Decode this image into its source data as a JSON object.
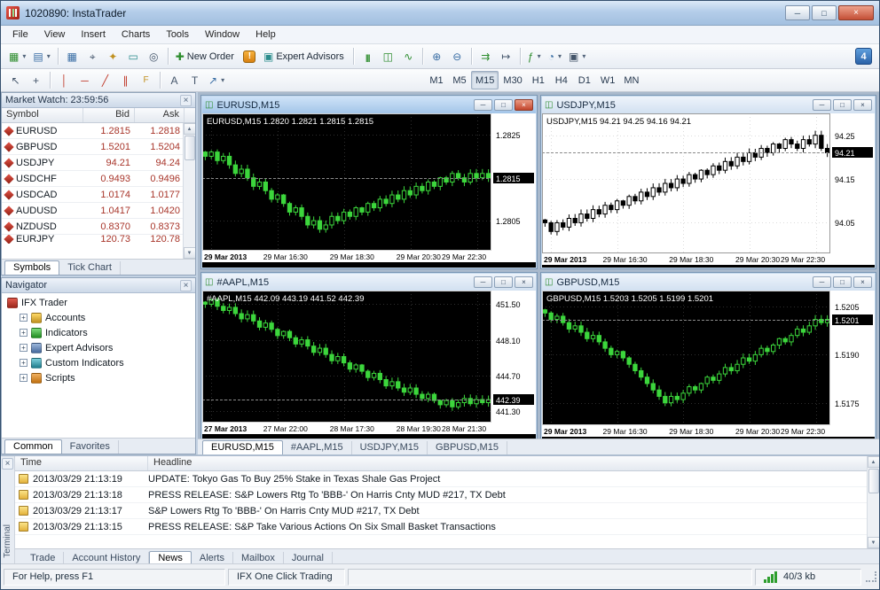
{
  "window": {
    "title": "1020890: InstaTrader"
  },
  "menu": {
    "items": [
      "File",
      "View",
      "Insert",
      "Charts",
      "Tools",
      "Window",
      "Help"
    ]
  },
  "toolbar": {
    "new_order_label": "New Order",
    "expert_advisors_label": "Expert Advisors",
    "notification_badge": "4",
    "timeframes": [
      "M1",
      "M5",
      "M15",
      "M30",
      "H1",
      "H4",
      "D1",
      "W1",
      "MN"
    ],
    "active_timeframe": "M15"
  },
  "icons": {
    "new_chart": "▦",
    "profiles": "▤",
    "market_watch": "▦",
    "data_window": "⌖",
    "navigator": "✦",
    "terminal_panel": "▭",
    "strategy_tester": "◎",
    "new_order": "✚",
    "alert": "!",
    "expert_advisors": "▣",
    "chart_bars": "|||",
    "chart_candles": "◫",
    "chart_line": "∿",
    "zoom_in": "⊕",
    "zoom_out": "⊖",
    "auto_scroll": "⇉",
    "chart_shift": "↦",
    "indicators": "ƒ",
    "periods": "◔",
    "templates": "▣",
    "dropdown": "▾",
    "cursor": "↖",
    "crosshair": "+",
    "vline": "│",
    "hline": "─",
    "trendline": "╱",
    "channel": "∥",
    "fibonacci": "F",
    "text": "A",
    "text_label": "T",
    "arrows": "↗",
    "minimize": "─",
    "maximize": "□",
    "close": "×",
    "scroll_up": "▲",
    "scroll_down": "▼",
    "expand": "+"
  },
  "market_watch": {
    "title": "Market Watch: 23:59:56",
    "columns": [
      "Symbol",
      "Bid",
      "Ask"
    ],
    "rows": [
      {
        "symbol": "EURUSD",
        "bid": "1.2815",
        "ask": "1.2818"
      },
      {
        "symbol": "GBPUSD",
        "bid": "1.5201",
        "ask": "1.5204"
      },
      {
        "symbol": "USDJPY",
        "bid": "94.21",
        "ask": "94.24"
      },
      {
        "symbol": "USDCHF",
        "bid": "0.9493",
        "ask": "0.9496"
      },
      {
        "symbol": "USDCAD",
        "bid": "1.0174",
        "ask": "1.0177"
      },
      {
        "symbol": "AUDUSD",
        "bid": "1.0417",
        "ask": "1.0420"
      },
      {
        "symbol": "NZDUSD",
        "bid": "0.8370",
        "ask": "0.8373"
      },
      {
        "symbol": "EURJPY",
        "bid": "120.73",
        "ask": "120.78"
      }
    ],
    "tabs": [
      "Symbols",
      "Tick Chart"
    ],
    "active_tab": "Symbols"
  },
  "navigator": {
    "title": "Navigator",
    "root": "IFX Trader",
    "items": [
      "Accounts",
      "Indicators",
      "Expert Advisors",
      "Custom Indicators",
      "Scripts"
    ],
    "tabs": [
      "Common",
      "Favorites"
    ],
    "active_tab": "Common"
  },
  "chart_tabs": {
    "items": [
      "EURUSD,M15",
      "#AAPL,M15",
      "USDJPY,M15",
      "GBPUSD,M15"
    ],
    "active": "EURUSD,M15"
  },
  "terminal": {
    "side_label": "Terminal",
    "columns": [
      "Time",
      "Headline"
    ],
    "news": [
      {
        "time": "2013/03/29 21:13:19",
        "headline": "UPDATE: Tokyo Gas To Buy 25% Stake in Texas Shale Gas Project"
      },
      {
        "time": "2013/03/29 21:13:18",
        "headline": "PRESS RELEASE: S&P Lowers Rtg To 'BBB-' On Harris Cnty MUD #217, TX Debt"
      },
      {
        "time": "2013/03/29 21:13:17",
        "headline": "S&P Lowers Rtg To 'BBB-' On Harris Cnty MUD #217, TX Debt"
      },
      {
        "time": "2013/03/29 21:13:15",
        "headline": "PRESS RELEASE: S&P Take Various Actions On Six Small Basket Transactions"
      }
    ],
    "tabs": [
      "Trade",
      "Account History",
      "News",
      "Alerts",
      "Mailbox",
      "Journal"
    ],
    "active_tab": "News"
  },
  "statusbar": {
    "help": "For Help, press F1",
    "one_click": "IFX One Click Trading",
    "traffic": "40/3 kb"
  },
  "chart_data": [
    {
      "type": "candlestick",
      "title": "EURUSD,M15",
      "theme": "dark",
      "info": "EURUSD,M15 1.2820 1.2821 1.2815 1.2815",
      "y_range": [
        1.2798,
        1.283
      ],
      "y_labels": [
        {
          "t": "1.2825",
          "v": 1.2825
        },
        {
          "t": "1.2815",
          "v": 1.2815,
          "hl": true
        },
        {
          "t": "1.2805",
          "v": 1.2805
        }
      ],
      "x_labels": [
        "29 Mar 2013",
        "29 Mar 16:30",
        "29 Mar 18:30",
        "29 Mar 20:30",
        "29 Mar 22:30"
      ],
      "closes": [
        1.282,
        1.2821,
        1.2819,
        1.282,
        1.2818,
        1.2816,
        1.2817,
        1.2815,
        1.2813,
        1.2814,
        1.2812,
        1.281,
        1.2811,
        1.2809,
        1.2807,
        1.2808,
        1.2806,
        1.2804,
        1.2805,
        1.2803,
        1.2804,
        1.2806,
        1.2805,
        1.2807,
        1.2806,
        1.2808,
        1.2807,
        1.2809,
        1.2808,
        1.281,
        1.2809,
        1.2811,
        1.281,
        1.2812,
        1.2811,
        1.2813,
        1.2812,
        1.2814,
        1.2813,
        1.2815,
        1.2814,
        1.2816,
        1.2815,
        1.2814,
        1.2816,
        1.2815,
        1.2816,
        1.2815
      ]
    },
    {
      "type": "candlestick",
      "title": "USDJPY,M15",
      "theme": "light",
      "info": "USDJPY,M15 94.21 94.25 94.16 94.21",
      "y_range": [
        93.98,
        94.3
      ],
      "y_labels": [
        {
          "t": "94.25",
          "v": 94.25
        },
        {
          "t": "94.21",
          "v": 94.21,
          "hl": true
        },
        {
          "t": "94.15",
          "v": 94.15
        },
        {
          "t": "94.05",
          "v": 94.05
        }
      ],
      "x_labels": [
        "29 Mar 2013",
        "29 Mar 16:30",
        "29 Mar 18:30",
        "29 Mar 20:30",
        "29 Mar 22:30"
      ],
      "closes": [
        94.05,
        94.03,
        94.05,
        94.04,
        94.06,
        94.05,
        94.07,
        94.06,
        94.08,
        94.07,
        94.09,
        94.08,
        94.1,
        94.09,
        94.11,
        94.1,
        94.12,
        94.11,
        94.13,
        94.12,
        94.14,
        94.13,
        94.15,
        94.14,
        94.16,
        94.15,
        94.17,
        94.16,
        94.18,
        94.17,
        94.19,
        94.18,
        94.2,
        94.19,
        94.21,
        94.2,
        94.22,
        94.21,
        94.23,
        94.22,
        94.24,
        94.23,
        94.22,
        94.24,
        94.23,
        94.25,
        94.22,
        94.21
      ]
    },
    {
      "type": "candlestick",
      "title": "#AAPL,M15",
      "theme": "dark",
      "info": "#AAPL,M15 442.09 443.19 441.52 442.39",
      "y_range": [
        440.2,
        452.8
      ],
      "y_labels": [
        {
          "t": "451.50",
          "v": 451.5
        },
        {
          "t": "448.10",
          "v": 448.1
        },
        {
          "t": "444.70",
          "v": 444.7
        },
        {
          "t": "442.39",
          "v": 442.39,
          "hl": true
        },
        {
          "t": "441.30",
          "v": 441.3
        }
      ],
      "x_labels": [
        "27 Mar 2013",
        "27 Mar 22:00",
        "28 Mar 17:30",
        "28 Mar 19:30",
        "28 Mar 21:30"
      ],
      "closes": [
        451.5,
        451.9,
        451.3,
        450.9,
        451.2,
        450.6,
        450.1,
        450.5,
        449.9,
        449.3,
        449.7,
        449.1,
        448.5,
        448.9,
        448.3,
        447.7,
        448.1,
        447.5,
        446.9,
        447.3,
        446.7,
        446.1,
        446.5,
        445.9,
        445.3,
        445.7,
        445.1,
        444.5,
        444.9,
        444.3,
        443.7,
        444.1,
        443.5,
        443.1,
        443.5,
        442.9,
        442.5,
        442.9,
        442.3,
        441.9,
        442.3,
        441.7,
        442.1,
        442.5,
        442.0,
        442.4,
        442.1,
        442.39
      ]
    },
    {
      "type": "candlestick",
      "title": "GBPUSD,M15",
      "theme": "dark",
      "info": "GBPUSD,M15 1.5203 1.5205 1.5199 1.5201",
      "y_range": [
        1.5168,
        1.521
      ],
      "y_labels": [
        {
          "t": "1.5205",
          "v": 1.5205
        },
        {
          "t": "1.5201",
          "v": 1.5201,
          "hl": true
        },
        {
          "t": "1.5190",
          "v": 1.519
        },
        {
          "t": "1.5175",
          "v": 1.5175
        }
      ],
      "x_labels": [
        "29 Mar 2013",
        "29 Mar 16:30",
        "29 Mar 18:30",
        "29 Mar 20:30",
        "29 Mar 22:30"
      ],
      "closes": [
        1.5203,
        1.5201,
        1.5202,
        1.52,
        1.5198,
        1.5199,
        1.5197,
        1.5195,
        1.5196,
        1.5194,
        1.5192,
        1.519,
        1.5191,
        1.5189,
        1.5187,
        1.5185,
        1.5183,
        1.5181,
        1.5179,
        1.5177,
        1.5175,
        1.5177,
        1.5176,
        1.5178,
        1.518,
        1.5179,
        1.5181,
        1.5183,
        1.5182,
        1.5184,
        1.5186,
        1.5185,
        1.5187,
        1.5189,
        1.5188,
        1.519,
        1.5192,
        1.5191,
        1.5193,
        1.5195,
        1.5194,
        1.5196,
        1.5198,
        1.5197,
        1.5199,
        1.5201,
        1.52,
        1.5201
      ]
    }
  ]
}
